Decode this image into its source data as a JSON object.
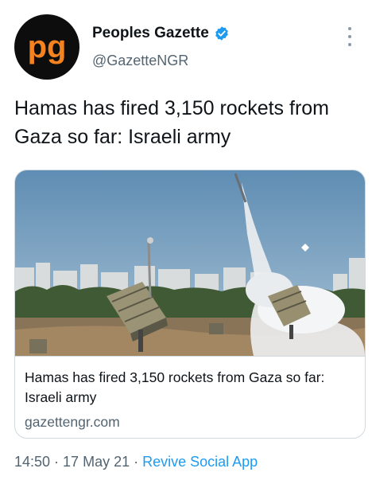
{
  "header": {
    "display_name": "Peoples Gazette",
    "handle": "@GazetteNGR",
    "avatar_text": "pg",
    "verified_icon": "verified-badge-icon",
    "more_icon": "more-vertical-icon"
  },
  "tweet": {
    "text": "Hamas has fired 3,150 rockets from Gaza so far: Israeli army"
  },
  "card": {
    "image_icon": "missile-launcher-photo",
    "title": "Hamas has fired 3,150 rockets from Gaza so far: Israeli army",
    "domain": "gazettengr.com"
  },
  "meta": {
    "time": "14:50",
    "separator": "·",
    "date": "17 May 21",
    "source": "Revive Social App"
  },
  "colors": {
    "brand_orange": "#f4821f",
    "link_blue": "#1d9bf0",
    "secondary_text": "#536471",
    "border": "#cfd9de"
  }
}
